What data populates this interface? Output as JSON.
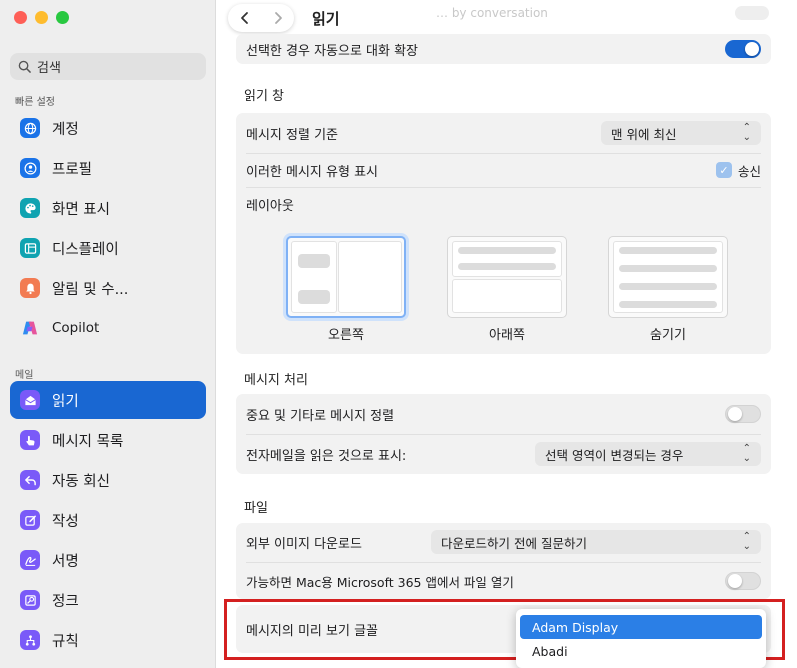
{
  "sidebar": {
    "search_placeholder": "검색",
    "quick_settings_label": "빠른 설정",
    "mail_label": "메일",
    "quick_items": [
      {
        "label": "계정",
        "icon": "globe-icon",
        "color": "#1a73e8"
      },
      {
        "label": "프로필",
        "icon": "person-icon",
        "color": "#1a73e8"
      },
      {
        "label": "화면 표시",
        "icon": "palette-icon",
        "color": "#0fa3b1"
      },
      {
        "label": "디스플레이",
        "icon": "display-icon",
        "color": "#0fa3b1"
      },
      {
        "label": "알림 및 수...",
        "icon": "bell-icon",
        "color": "#f27b52"
      },
      {
        "label": "Copilot",
        "icon": "copilot-icon",
        "color": "#8a5cf6"
      }
    ],
    "mail_items": [
      {
        "label": "읽기",
        "icon": "envelope-open-icon",
        "color": "#7a5af8",
        "selected": true
      },
      {
        "label": "메시지 목록",
        "icon": "hand-pointer-icon",
        "color": "#7a5af8"
      },
      {
        "label": "자동 회신",
        "icon": "reply-icon",
        "color": "#7a5af8"
      },
      {
        "label": "작성",
        "icon": "compose-icon",
        "color": "#7a5af8"
      },
      {
        "label": "서명",
        "icon": "signature-icon",
        "color": "#7a5af8"
      },
      {
        "label": "정크",
        "icon": "junk-icon",
        "color": "#7a5af8"
      },
      {
        "label": "규칙",
        "icon": "rules-icon",
        "color": "#7a5af8"
      }
    ]
  },
  "header": {
    "title": "읽기",
    "ghost_text": "… by conversation"
  },
  "conversation": {
    "expand_label": "선택한 경우 자동으로 대화 확장",
    "expand_on": true
  },
  "reading_pane": {
    "section_title": "읽기 창",
    "sort_label": "메시지 정렬 기준",
    "sort_value": "맨 위에 최신",
    "show_types_label": "이러한 메시지 유형 표시",
    "sent_label": "송신",
    "sent_checked": true,
    "layout_label": "레이아웃",
    "layouts": [
      {
        "label": "오른쪽",
        "selected": true
      },
      {
        "label": "아래쪽",
        "selected": false
      },
      {
        "label": "숨기기",
        "selected": false
      }
    ]
  },
  "message_handling": {
    "section_title": "메시지 처리",
    "sort_important_label": "중요 및 기타로 메시지 정렬",
    "sort_important_on": false,
    "mark_read_label": "전자메일을 읽은 것으로 표시:",
    "mark_read_value": "선택 영역이 변경되는 경우"
  },
  "files": {
    "section_title": "파일",
    "download_images_label": "외부 이미지 다운로드",
    "download_images_value": "다운로드하기 전에 질문하기",
    "open_in_apps_label": "가능하면 Mac용 Microsoft 365 앱에서 파일 열기",
    "open_in_apps_on": false
  },
  "font_preview": {
    "label": "메시지의 미리 보기 글꼴",
    "options": [
      "Adam Display",
      "Abadi"
    ],
    "selected": "Adam Display"
  },
  "colors": {
    "accent": "#1967d2",
    "highlight": "#d42020"
  }
}
